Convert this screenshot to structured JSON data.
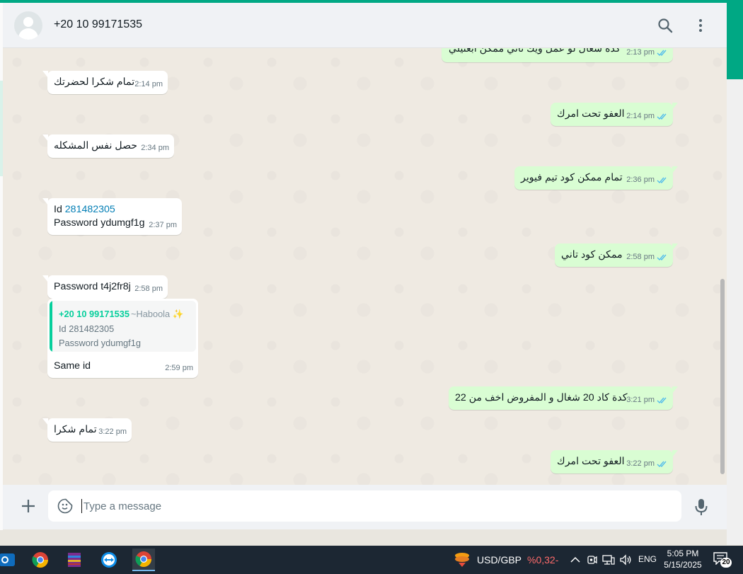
{
  "header": {
    "contact": "+20 10 99171535",
    "search_icon": "search-icon",
    "menu_icon": "more-vertical-icon"
  },
  "messages": [
    {
      "dir": "out",
      "text": "كدة شغال لو عمل ويك تاني ممكن ابعتيلي",
      "time": "2:13 pm"
    },
    {
      "dir": "in",
      "text": "تمام شكرا لحضرتك",
      "time": "2:14 pm"
    },
    {
      "dir": "out",
      "text": "العفو تحت امرك",
      "time": "2:14 pm"
    },
    {
      "dir": "in",
      "text": "حصل نفس المشكله",
      "time": "2:34 pm"
    },
    {
      "dir": "out",
      "text": "تمام ممكن كود تيم فيوير",
      "time": "2:36 pm"
    },
    {
      "dir": "in",
      "line1_label": "Id",
      "line1_value": "281482305",
      "line2": "Password ydumgf1g",
      "time": "2:37 pm"
    },
    {
      "dir": "out",
      "text": "ممكن كود تاني",
      "time": "2:58 pm"
    },
    {
      "dir": "in",
      "text": "Password t4j2fr8j",
      "time": "2:58 pm"
    },
    {
      "dir": "in",
      "quote": {
        "name": "+20 10 99171535",
        "alias": "~Haboola ✨",
        "line1": "Id 281482305",
        "line2": "Password ydumgf1g"
      },
      "text": "Same id",
      "time": "2:59 pm"
    },
    {
      "dir": "out",
      "text": "كدة كاد 20 شغال و المفروض اخف من 22",
      "time": "3:21 pm"
    },
    {
      "dir": "in",
      "text": "تمام شكرا",
      "time": "3:22 pm"
    },
    {
      "dir": "out",
      "text": "العفو تحت امرك",
      "time": "3:22 pm"
    }
  ],
  "composer": {
    "placeholder": "Type a message"
  },
  "taskbar": {
    "ticker_symbol": "USD/GBP",
    "ticker_change": "%0,32-",
    "language": "ENG",
    "time": "5:05 PM",
    "date": "5/15/2025",
    "notification_count": "20"
  },
  "colors": {
    "accent": "#00a884",
    "outgoing_bubble": "#d9fdd3",
    "incoming_bubble": "#ffffff",
    "read_tick": "#53bdeb"
  }
}
